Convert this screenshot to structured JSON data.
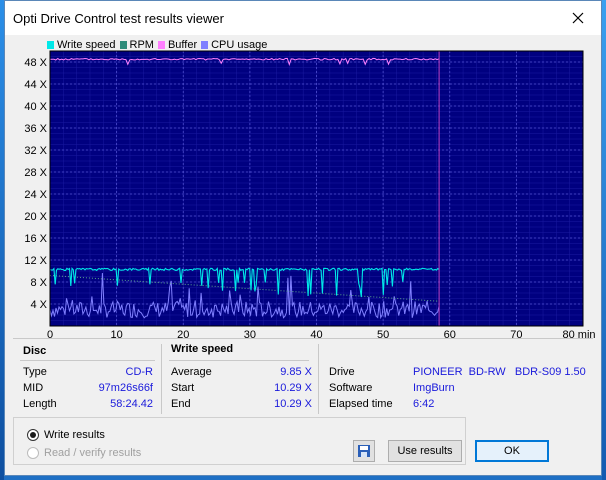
{
  "window": {
    "title": "Opti Drive Control test results viewer"
  },
  "legend": [
    {
      "label": "Write speed",
      "color": "#00e8e8"
    },
    {
      "label": "RPM",
      "color": "#2e8b7a"
    },
    {
      "label": "Buffer",
      "color": "#ff80ff"
    },
    {
      "label": "CPU usage",
      "color": "#8080ff"
    }
  ],
  "chart_data": {
    "type": "line",
    "x_ticks": [
      "0",
      "10",
      "20",
      "30",
      "40",
      "50",
      "60",
      "70",
      "80 min"
    ],
    "y_ticks": [
      "4 X",
      "8 X",
      "12 X",
      "16 X",
      "20 X",
      "24 X",
      "28 X",
      "32 X",
      "36 X",
      "40 X",
      "44 X",
      "48 X"
    ],
    "xlim": [
      0,
      80
    ],
    "ylim": [
      0,
      50
    ],
    "end_marker_min": 58.4,
    "series": [
      {
        "name": "Write speed",
        "color": "#00e8e8",
        "x": [
          0,
          58.4
        ],
        "y": [
          10.3,
          10.3
        ]
      },
      {
        "name": "Buffer",
        "color": "#ff80ff",
        "x": [
          0,
          58.4
        ],
        "y": [
          48.5,
          48.5
        ]
      },
      {
        "name": "RPM",
        "color": "#2e8b7a",
        "x": [
          0,
          58.4
        ],
        "y": [
          9.2,
          4.5
        ]
      },
      {
        "name": "CPU usage",
        "color": "#8080ff",
        "x": [
          0,
          58.4
        ],
        "y": [
          1.5,
          1.5
        ]
      }
    ]
  },
  "disc": {
    "heading": "Disc",
    "rows": [
      {
        "label": "Type",
        "value": "CD-R"
      },
      {
        "label": "MID",
        "value": "97m26s66f"
      },
      {
        "label": "Length",
        "value": "58:24.42"
      }
    ]
  },
  "write_speed": {
    "heading": "Write speed",
    "rows": [
      {
        "label": "Average",
        "value": "9.85 X"
      },
      {
        "label": "Start",
        "value": "10.29 X"
      },
      {
        "label": "End",
        "value": "10.29 X"
      }
    ]
  },
  "drive_info": {
    "rows": [
      {
        "label": "Drive",
        "value": "PIONEER  BD-RW   BDR-S09 1.50"
      },
      {
        "label": "Software",
        "value": "ImgBurn"
      },
      {
        "label": "Elapsed time",
        "value": "6:42"
      }
    ]
  },
  "options": {
    "write_results": "Write results",
    "read_verify_results": "Read / verify results"
  },
  "buttons": {
    "use_results": "Use results",
    "ok": "OK"
  }
}
